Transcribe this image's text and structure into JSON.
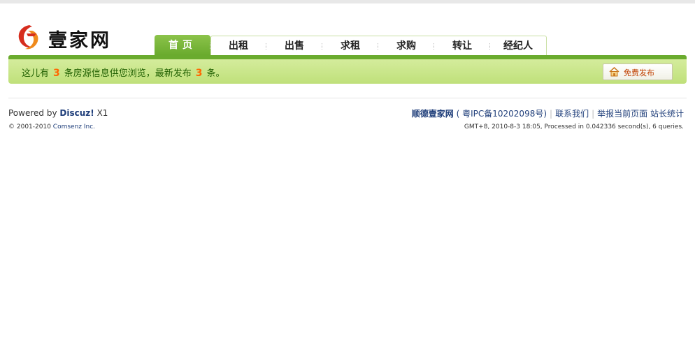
{
  "header": {
    "logo_text": "壹家网"
  },
  "nav": {
    "items": [
      {
        "label": "首页"
      },
      {
        "label": "出租"
      },
      {
        "label": "出售"
      },
      {
        "label": "求租"
      },
      {
        "label": "求购"
      },
      {
        "label": "转让"
      },
      {
        "label": "经纪人"
      }
    ],
    "active_index": 0
  },
  "infobar": {
    "prefix": "这儿有",
    "count_total": "3",
    "middle": "条房源信息供您浏览，最新发布",
    "count_new": "3",
    "suffix": "条。",
    "publish_label": "免费发布"
  },
  "footer": {
    "powered_prefix": "Powered by",
    "powered_brand": "Discuz!",
    "powered_version": "X1",
    "copyright_prefix": "© 2001-2010",
    "copyright_company": "Comsenz Inc.",
    "site_name": "顺德壹家网",
    "icp": "( 粤IPC备10202098号)",
    "contact": "联系我们",
    "report": "举报当前页面",
    "stats": "站长统计",
    "gmt": "GMT+8, 2010-8-3 18:05, Processed in 0.042336 second(s), 6 queries."
  },
  "colors": {
    "accent_green": "#6aab2e",
    "infobar_green": "#c6e486",
    "count_orange": "#ff6600",
    "link_blue": "#1f3e7a"
  }
}
